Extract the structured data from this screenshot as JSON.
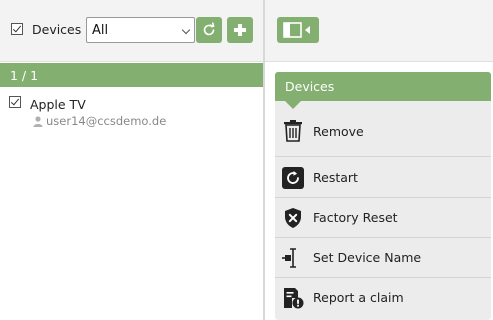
{
  "toolbar": {
    "devices_label": "Devices",
    "filter_value": "All"
  },
  "list": {
    "count_text": "1 / 1",
    "devices": [
      {
        "name": "Apple TV",
        "user": "user14@ccsdemo.de"
      }
    ]
  },
  "menu": {
    "header": "Devices",
    "items": [
      {
        "label": "Remove",
        "icon": "trash-icon"
      },
      {
        "label": "Restart",
        "icon": "restart-icon"
      },
      {
        "label": "Factory Reset",
        "icon": "shield-x-icon"
      },
      {
        "label": "Set Device Name",
        "icon": "text-cursor-icon"
      },
      {
        "label": "Report a claim",
        "icon": "report-alert-icon"
      }
    ]
  },
  "colors": {
    "accent": "#83b070",
    "menu_bg": "#ececec"
  }
}
